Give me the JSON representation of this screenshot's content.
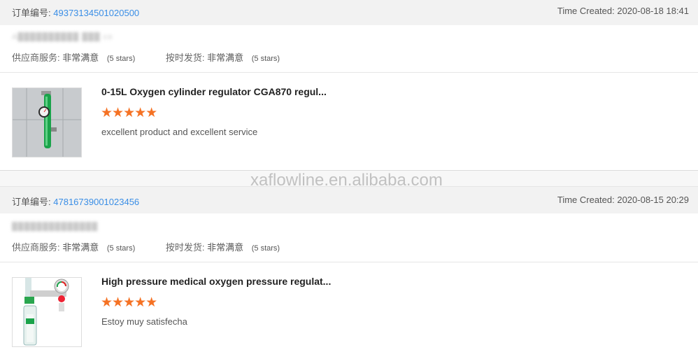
{
  "watermark": "xaflowline.en.alibaba.com",
  "orders": [
    {
      "order_label": "订单编号:",
      "order_number": "49373134501020500",
      "time_created": "Time Created: 2020-08-18 18:41",
      "buyer_masked": "A██████████ ███ co",
      "supplier_service_label": "供应商服务:",
      "supplier_service_value": "非常满意",
      "supplier_service_stars": "(5 stars)",
      "ontime_label": "按时发货:",
      "ontime_value": "非常满意",
      "ontime_stars": "(5 stars)",
      "product_title": "0-15L Oxygen cylinder regulator CGA870 regul...",
      "rating_stars": "★★★★★",
      "comment": "excellent product and excellent service"
    },
    {
      "order_label": "订单编号:",
      "order_number": "47816739001023456",
      "time_created": "Time Created: 2020-08-15 20:29",
      "buyer_masked": "██████████████",
      "supplier_service_label": "供应商服务:",
      "supplier_service_value": "非常满意",
      "supplier_service_stars": "(5 stars)",
      "ontime_label": "按时发货:",
      "ontime_value": "非常满意",
      "ontime_stars": "(5 stars)",
      "product_title": "High pressure medical oxygen pressure regulat...",
      "rating_stars": "★★★★★",
      "comment": "Estoy muy satisfecha"
    }
  ],
  "colors": {
    "accent_link": "#3a8ee6",
    "star": "#f57224",
    "regulator_green": "#1aa34a"
  }
}
